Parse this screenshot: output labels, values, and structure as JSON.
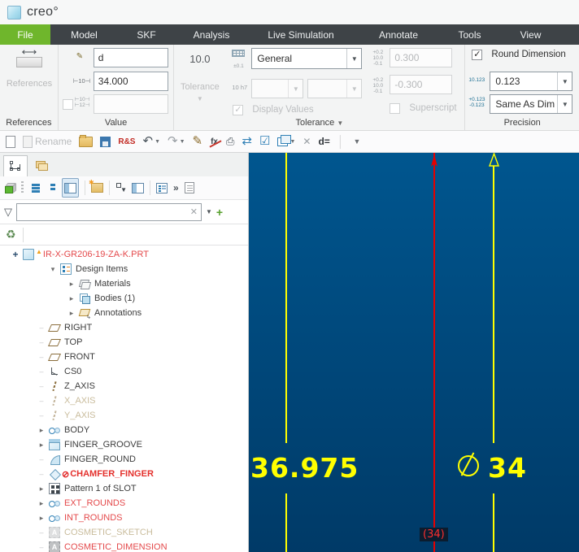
{
  "window": {
    "app_name": "creo°"
  },
  "tabs": {
    "active": "File",
    "items": [
      "File",
      "Model",
      "SKF",
      "Analysis",
      "Live Simulation",
      "Annotate",
      "Tools",
      "View"
    ]
  },
  "ribbon": {
    "references": {
      "button": "References",
      "group": "References"
    },
    "value": {
      "name": "d",
      "value": "34.000",
      "secondary_value": "",
      "icon_nominal": "⊢10⊣",
      "icon_dual_top": "⊢10⊣",
      "icon_dual_bottom": "⊢12⊣",
      "group": "Value"
    },
    "tolerance": {
      "button_icon": "10.0",
      "button": "Tolerance",
      "table_icon": "±0.1",
      "mode": "General",
      "fit_icon": "10 h7",
      "display_values": "Display Values",
      "tol_icon_top": "+0.2",
      "tol_icon_mid": "10.0",
      "tol_icon_bottom": "-0.1",
      "upper": "0.300",
      "lower": "-0.300",
      "superscript": "Superscript",
      "group": "Tolerance"
    },
    "precision": {
      "round_dimension": "Round Dimension",
      "decimal_icon": "10.123",
      "decimal": "0.123",
      "tol_icon_top": "+0.123",
      "tol_icon_bottom": "-0.123",
      "tolerance_precision": "Same As Dim",
      "group": "Precision"
    }
  },
  "quick_toolbar": {
    "rename": "Rename",
    "relations": "R&S",
    "dim_eq": "d="
  },
  "model_tree": {
    "filter_value": "",
    "items": [
      {
        "icon": "part",
        "label": "IR-X-GR206-19-ZA-K.PRT",
        "color": "red",
        "warning": true,
        "expander": "plus"
      },
      {
        "icon": "design-items",
        "label": "Design Items",
        "expander": "open",
        "color": "normal"
      },
      {
        "icon": "materials",
        "label": "Materials",
        "expander": "closed",
        "color": "normal"
      },
      {
        "icon": "bodies",
        "label": "Bodies (1)",
        "expander": "closed",
        "color": "normal"
      },
      {
        "icon": "annotations",
        "label": "Annotations",
        "expander": "closed",
        "color": "normal"
      },
      {
        "icon": "plane",
        "label": "RIGHT",
        "color": "normal"
      },
      {
        "icon": "plane",
        "label": "TOP",
        "color": "normal"
      },
      {
        "icon": "plane",
        "label": "FRONT",
        "color": "normal"
      },
      {
        "icon": "csys",
        "label": "CS0",
        "color": "normal"
      },
      {
        "icon": "axis",
        "label": "Z_AXIS",
        "color": "normal"
      },
      {
        "icon": "axis",
        "label": "X_AXIS",
        "color": "dim"
      },
      {
        "icon": "axis",
        "label": "Y_AXIS",
        "color": "dim"
      },
      {
        "icon": "revolve",
        "label": "BODY",
        "expander": "closed",
        "color": "normal"
      },
      {
        "icon": "extrude",
        "label": "FINGER_GROOVE",
        "expander": "closed",
        "color": "normal"
      },
      {
        "icon": "round",
        "label": "FINGER_ROUND",
        "color": "normal"
      },
      {
        "icon": "chamfer",
        "label": "CHAMFER_FINGER",
        "color": "red-bold",
        "failed": true
      },
      {
        "icon": "pattern",
        "label": "Pattern 1 of SLOT",
        "expander": "closed",
        "color": "normal"
      },
      {
        "icon": "round-set",
        "label": "EXT_ROUNDS",
        "expander": "closed",
        "color": "red"
      },
      {
        "icon": "round-set",
        "label": "INT_ROUNDS",
        "expander": "closed",
        "color": "red"
      },
      {
        "icon": "cosmetic",
        "label": "COSMETIC_SKETCH",
        "color": "dim"
      },
      {
        "icon": "cosmetic",
        "label": "COSMETIC_DIMENSION",
        "color": "red"
      }
    ]
  },
  "graphics": {
    "dim_edit": "36.975",
    "dim_diameter": "34",
    "ref_dim": "(34)",
    "colors": {
      "dimension": "#ffff00",
      "centerline": "#e60000",
      "bg_top": "#00568f",
      "bg_bottom": "#003a67"
    }
  }
}
